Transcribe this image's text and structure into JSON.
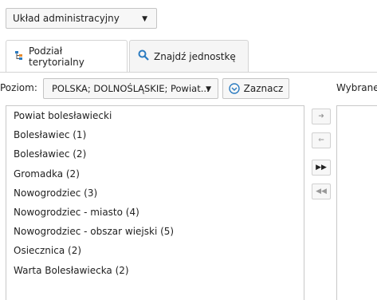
{
  "layout_select": {
    "label": "Układ administracyjny"
  },
  "tabs": [
    {
      "label": "Podział terytorialny",
      "icon": "tree-icon",
      "active": true
    },
    {
      "label": "Znajdź jednostkę",
      "icon": "search-icon",
      "active": false
    }
  ],
  "level": {
    "label": "Poziom:",
    "value": "POLSKA; DOLNOŚLĄSKIE; Powiat...",
    "mark_button": "Zaznacz"
  },
  "selected_label": "Wybrane",
  "units": [
    "Powiat bolesławiecki",
    "Bolesławiec (1)",
    "Bolesławiec (2)",
    "Gromadka (2)",
    "Nowogrodziec (3)",
    "Nowogrodziec - miasto (4)",
    "Nowogrodziec - obszar wiejski (5)",
    "Osiecznica (2)",
    "Warta Bolesławiecka (2)"
  ],
  "move_buttons": [
    {
      "glyph": "➜",
      "name": "move-right-button",
      "enabled": false
    },
    {
      "glyph": "⇐",
      "name": "move-left-button",
      "enabled": false
    },
    {
      "glyph": "▶▶",
      "name": "move-all-right-button",
      "enabled": true
    },
    {
      "glyph": "◀◀",
      "name": "move-all-left-button",
      "enabled": false
    }
  ],
  "colors": {
    "accent": "#2b7bc0",
    "border": "#c8c8c8"
  }
}
